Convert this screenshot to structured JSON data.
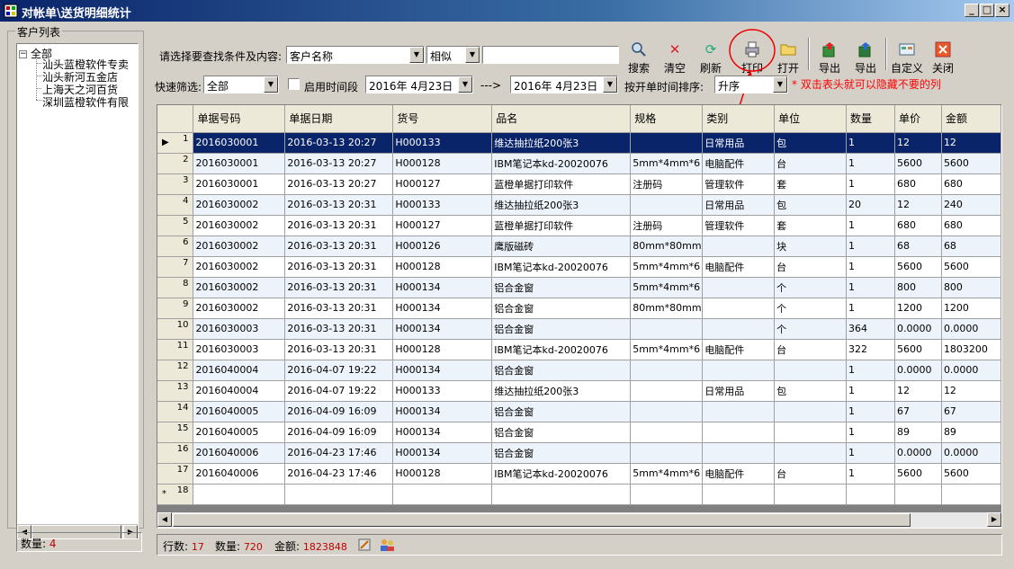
{
  "window": {
    "title": "对帐单\\送货明细统计",
    "min_label": "_",
    "max_label": "□",
    "close_label": "×"
  },
  "customer_panel": {
    "title": "客户列表",
    "root_label": "全部",
    "customers": [
      "汕头蓝橙软件专卖",
      "汕头新河五金店",
      "上海天之河百货",
      "深圳蓝橙软件有限"
    ],
    "count_label": "数量:",
    "count_value": "4"
  },
  "search": {
    "prompt": "请选择要查找条件及内容:",
    "field_value": "客户名称",
    "match_value": "相似",
    "query_value": ""
  },
  "toolbar": {
    "buttons": [
      {
        "label": "搜索",
        "icon": "search-icon"
      },
      {
        "label": "清空",
        "icon": "clear-icon"
      },
      {
        "label": "刷新",
        "icon": "refresh-icon"
      },
      {
        "label": "打印",
        "icon": "printer-icon"
      },
      {
        "label": "打开",
        "icon": "folder-open-icon"
      },
      {
        "label": "导出",
        "icon": "export-icon"
      },
      {
        "label": "导出",
        "icon": "export-excel-icon"
      },
      {
        "label": "自定义",
        "icon": "customize-icon"
      },
      {
        "label": "关闭",
        "icon": "close-icon"
      }
    ]
  },
  "filter": {
    "quick_label": "快速筛选:",
    "quick_value": "全部",
    "use_period_label": "启用时间段",
    "date_from": "2016年 4月23日",
    "range_arrow": "--->",
    "date_to": "2016年 4月23日",
    "sort_label": "按开单时间排序:",
    "sort_value": "升序",
    "hint": "* 双击表头就可以隐藏不要的列"
  },
  "grid": {
    "columns": [
      "单据号码",
      "单据日期",
      "货号",
      "品名",
      "规格",
      "类别",
      "单位",
      "数量",
      "单价",
      "金额"
    ],
    "rows": [
      [
        "2016030001",
        "2016-03-13 20:27",
        "H000133",
        "维达抽拉纸200张3",
        "",
        "日常用品",
        "包",
        "1",
        "12",
        "12"
      ],
      [
        "2016030001",
        "2016-03-13 20:27",
        "H000128",
        "IBM笔记本kd-20020076",
        "5mm*4mm*6",
        "电脑配件",
        "台",
        "1",
        "5600",
        "5600"
      ],
      [
        "2016030001",
        "2016-03-13 20:27",
        "H000127",
        "蓝橙单据打印软件",
        "注册码",
        "管理软件",
        "套",
        "1",
        "680",
        "680"
      ],
      [
        "2016030002",
        "2016-03-13 20:31",
        "H000133",
        "维达抽拉纸200张3",
        "",
        "日常用品",
        "包",
        "20",
        "12",
        "240"
      ],
      [
        "2016030002",
        "2016-03-13 20:31",
        "H000127",
        "蓝橙单据打印软件",
        "注册码",
        "管理软件",
        "套",
        "1",
        "680",
        "680"
      ],
      [
        "2016030002",
        "2016-03-13 20:31",
        "H000126",
        "鹰版磁砖",
        "80mm*80mm",
        "",
        "块",
        "1",
        "68",
        "68"
      ],
      [
        "2016030002",
        "2016-03-13 20:31",
        "H000128",
        "IBM笔记本kd-20020076",
        "5mm*4mm*6",
        "电脑配件",
        "台",
        "1",
        "5600",
        "5600"
      ],
      [
        "2016030002",
        "2016-03-13 20:31",
        "H000134",
        "铝合金窗",
        "5mm*4mm*6",
        "",
        "个",
        "1",
        "800",
        "800"
      ],
      [
        "2016030002",
        "2016-03-13 20:31",
        "H000134",
        "铝合金窗",
        "80mm*80mm",
        "",
        "个",
        "1",
        "1200",
        "1200"
      ],
      [
        "2016030003",
        "2016-03-13 20:31",
        "H000134",
        "铝合金窗",
        "",
        "",
        "个",
        "364",
        "0.0000",
        "0.0000"
      ],
      [
        "2016030003",
        "2016-03-13 20:31",
        "H000128",
        "IBM笔记本kd-20020076",
        "5mm*4mm*6",
        "电脑配件",
        "台",
        "322",
        "5600",
        "1803200"
      ],
      [
        "2016040004",
        "2016-04-07 19:22",
        "H000134",
        "铝合金窗",
        "",
        "",
        "",
        "1",
        "0.0000",
        "0.0000"
      ],
      [
        "2016040004",
        "2016-04-07 19:22",
        "H000133",
        "维达抽拉纸200张3",
        "",
        "日常用品",
        "包",
        "1",
        "12",
        "12"
      ],
      [
        "2016040005",
        "2016-04-09 16:09",
        "H000134",
        "铝合金窗",
        "",
        "",
        "",
        "1",
        "67",
        "67"
      ],
      [
        "2016040005",
        "2016-04-09 16:09",
        "H000134",
        "铝合金窗",
        "",
        "",
        "",
        "1",
        "89",
        "89"
      ],
      [
        "2016040006",
        "2016-04-23 17:46",
        "H000134",
        "铝合金窗",
        "",
        "",
        "",
        "1",
        "0.0000",
        "0.0000"
      ],
      [
        "2016040006",
        "2016-04-23 17:46",
        "H000128",
        "IBM笔记本kd-20020076",
        "5mm*4mm*6",
        "电脑配件",
        "台",
        "1",
        "5600",
        "5600"
      ]
    ],
    "new_row_number": "18",
    "new_row_marker": "*"
  },
  "status": {
    "rows_label": "行数:",
    "rows_value": "17",
    "qty_label": "数量:",
    "qty_value": "720",
    "amount_label": "金额:",
    "amount_value": "1823848"
  }
}
